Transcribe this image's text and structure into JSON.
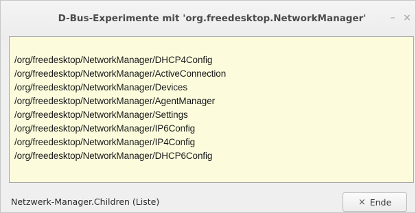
{
  "window": {
    "title": "D-Bus-Experimente mit 'org.freedesktop.NetworkManager'",
    "minimize_glyph": "–",
    "close_glyph": "×"
  },
  "list": {
    "items": [
      "/org/freedesktop/NetworkManager/DHCP4Config",
      "/org/freedesktop/NetworkManager/ActiveConnection",
      "/org/freedesktop/NetworkManager/Devices",
      "/org/freedesktop/NetworkManager/AgentManager",
      "/org/freedesktop/NetworkManager/Settings",
      "/org/freedesktop/NetworkManager/IP6Config",
      "/org/freedesktop/NetworkManager/IP4Config",
      "/org/freedesktop/NetworkManager/DHCP6Config"
    ],
    "background_color": "#fcfcdd"
  },
  "status": {
    "text": "Netzwerk-Manager.Children (Liste)"
  },
  "end_button": {
    "label": "Ende",
    "icon": "close-icon",
    "icon_glyph": "×"
  }
}
